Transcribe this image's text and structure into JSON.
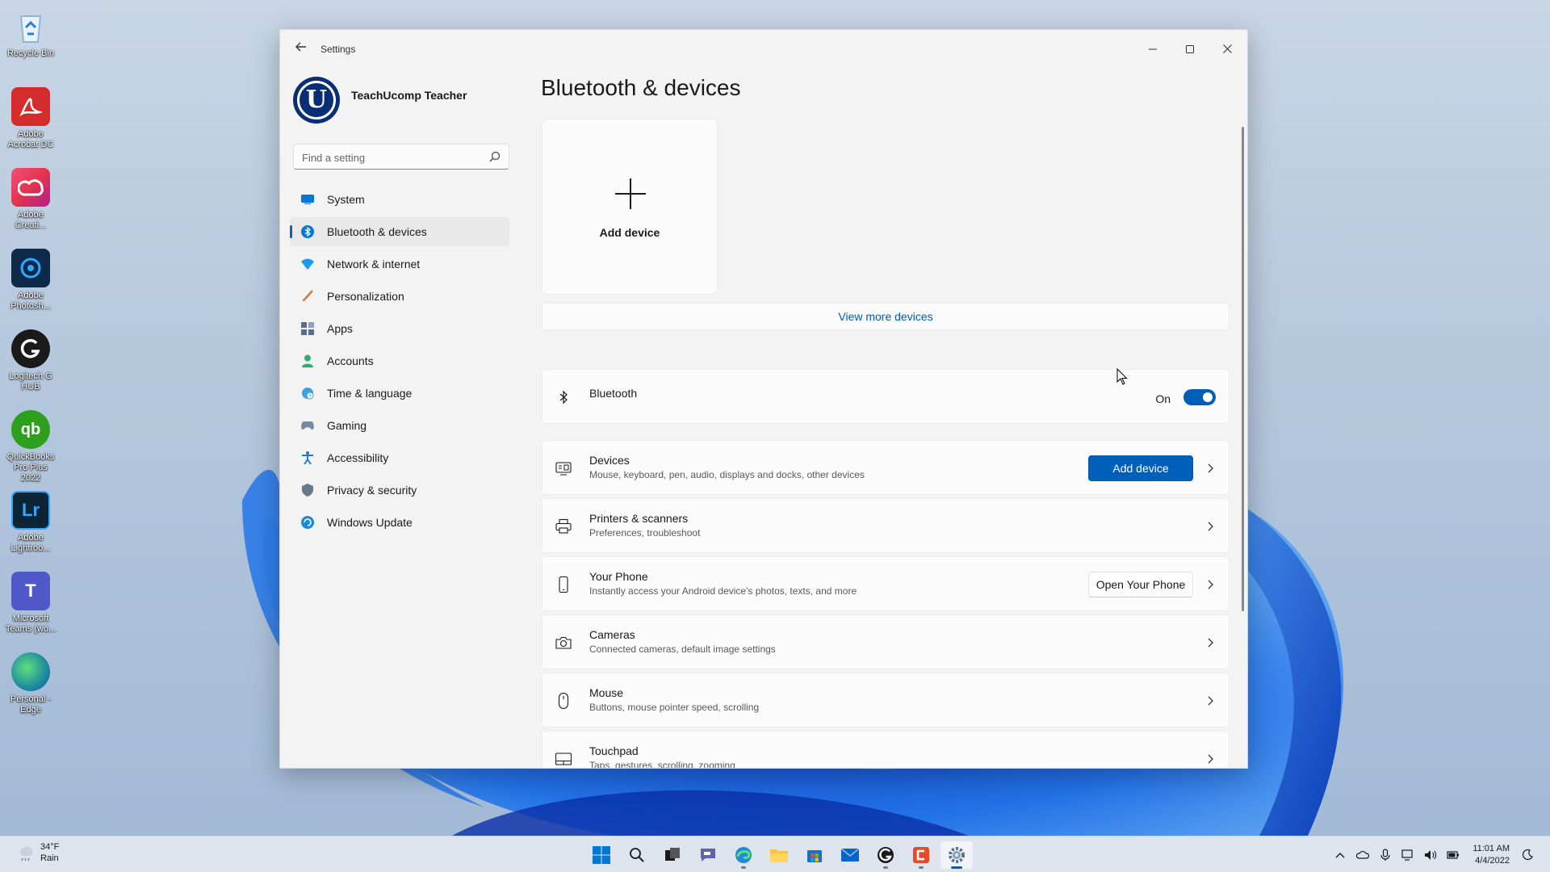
{
  "desktop": {
    "icons": [
      {
        "label": "Recycle Bin",
        "icon": "recycle-bin-icon",
        "color": "#6aa3d9"
      },
      {
        "label": "Adobe Acrobat DC",
        "icon": "adobe-acrobat-icon",
        "color": "#d42b2b"
      },
      {
        "label": "Adobe Creati...",
        "icon": "adobe-creative-cloud-icon",
        "color": "#e2344d"
      },
      {
        "label": "Adobe Photosh...",
        "icon": "adobe-photoshop-icon",
        "color": "#0d2a4a"
      },
      {
        "label": "Logitech G HUB",
        "icon": "logitech-g-hub-icon",
        "color": "#1a1a1a"
      },
      {
        "label": "QuickBooks Pro Plus 2022",
        "icon": "quickbooks-icon",
        "color": "#2ca01c"
      },
      {
        "label": "Adobe Lightroo...",
        "icon": "adobe-lightroom-icon",
        "color": "#0b2537"
      },
      {
        "label": "Microsoft Teams (wo...",
        "icon": "microsoft-teams-icon",
        "color": "#5059c9"
      },
      {
        "label": "Personal - Edge",
        "icon": "edge-icon",
        "color": "#1f8a9e"
      }
    ]
  },
  "window": {
    "title": "Settings",
    "back_icon": "back-arrow-icon"
  },
  "profile": {
    "name": "TeachUcomp Teacher",
    "avatar_letter": "U",
    "avatar_color": "#0a2e73"
  },
  "search": {
    "placeholder": "Find a setting",
    "value": ""
  },
  "nav": {
    "items": [
      {
        "label": "System",
        "icon": "system-monitor-icon",
        "active": false
      },
      {
        "label": "Bluetooth & devices",
        "icon": "bluetooth-icon",
        "active": true
      },
      {
        "label": "Network & internet",
        "icon": "wifi-icon",
        "active": false
      },
      {
        "label": "Personalization",
        "icon": "brush-icon",
        "active": false
      },
      {
        "label": "Apps",
        "icon": "apps-icon",
        "active": false
      },
      {
        "label": "Accounts",
        "icon": "person-icon",
        "active": false
      },
      {
        "label": "Time & language",
        "icon": "globe-clock-icon",
        "active": false
      },
      {
        "label": "Gaming",
        "icon": "gamepad-icon",
        "active": false
      },
      {
        "label": "Accessibility",
        "icon": "accessibility-icon",
        "active": false
      },
      {
        "label": "Privacy & security",
        "icon": "shield-icon",
        "active": false
      },
      {
        "label": "Windows Update",
        "icon": "update-icon",
        "active": false
      }
    ]
  },
  "main": {
    "page_title": "Bluetooth & devices",
    "add_tile_label": "Add device",
    "view_more": "View more devices",
    "bluetooth": {
      "title": "Bluetooth",
      "state_label": "On",
      "enabled": true
    },
    "cards": [
      {
        "title": "Devices",
        "subtitle": "Mouse, keyboard, pen, audio, displays and docks, other devices",
        "icon": "devices-icon",
        "button": "Add device",
        "button_style": "primary"
      },
      {
        "title": "Printers & scanners",
        "subtitle": "Preferences, troubleshoot",
        "icon": "printer-icon"
      },
      {
        "title": "Your Phone",
        "subtitle": "Instantly access your Android device's photos, texts, and more",
        "icon": "phone-icon",
        "button": "Open Your Phone",
        "button_style": "secondary"
      },
      {
        "title": "Cameras",
        "subtitle": "Connected cameras, default image settings",
        "icon": "camera-icon"
      },
      {
        "title": "Mouse",
        "subtitle": "Buttons, mouse pointer speed, scrolling",
        "icon": "mouse-icon"
      },
      {
        "title": "Touchpad",
        "subtitle": "Taps, gestures, scrolling, zooming",
        "icon": "touchpad-icon"
      }
    ]
  },
  "taskbar": {
    "weather_temp": "34°F",
    "weather_desc": "Rain",
    "apps": [
      {
        "icon": "start-windows-icon"
      },
      {
        "icon": "search-icon"
      },
      {
        "icon": "task-view-icon"
      },
      {
        "icon": "teams-chat-icon"
      },
      {
        "icon": "edge-icon"
      },
      {
        "icon": "file-explorer-icon"
      },
      {
        "icon": "microsoft-store-icon"
      },
      {
        "icon": "mail-icon"
      },
      {
        "icon": "logitech-g-hub-icon"
      },
      {
        "icon": "camtasia-icon"
      },
      {
        "icon": "settings-gear-icon"
      }
    ],
    "time": "11:01 AM",
    "date": "4/4/2022"
  },
  "colors": {
    "accent": "#005fb8",
    "link": "#0059b3"
  }
}
